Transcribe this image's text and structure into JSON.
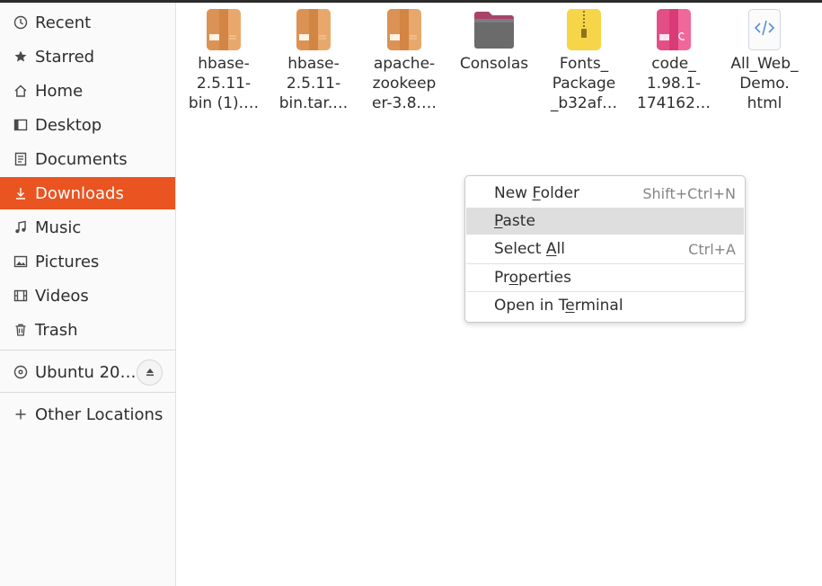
{
  "sidebar": {
    "items": [
      {
        "label": "Recent",
        "icon": "clock-icon"
      },
      {
        "label": "Starred",
        "icon": "star-icon"
      },
      {
        "label": "Home",
        "icon": "home-icon"
      },
      {
        "label": "Desktop",
        "icon": "desktop-icon"
      },
      {
        "label": "Documents",
        "icon": "document-icon"
      },
      {
        "label": "Downloads",
        "icon": "download-icon",
        "active": true
      },
      {
        "label": "Music",
        "icon": "music-icon"
      },
      {
        "label": "Pictures",
        "icon": "pictures-icon"
      },
      {
        "label": "Videos",
        "icon": "video-icon"
      },
      {
        "label": "Trash",
        "icon": "trash-icon"
      }
    ],
    "drive": {
      "label": "Ubuntu 20…",
      "icon": "disc-icon",
      "eject_icon": "eject-icon"
    },
    "other_locations": {
      "label": "Other Locations",
      "icon": "plus-icon"
    },
    "accent": "#e95420"
  },
  "files": [
    {
      "name": "hbase-\n2.5.11-\nbin (1).…",
      "icon": "archive-icon"
    },
    {
      "name": "hbase-\n2.5.11-\nbin.tar.…",
      "icon": "archive-icon"
    },
    {
      "name": "apache-\nzookeep\ner-3.8.…",
      "icon": "archive-icon"
    },
    {
      "name": "Consolas",
      "icon": "folder-icon"
    },
    {
      "name": "Fonts_\nPackage\n_b32af…",
      "icon": "zip-icon"
    },
    {
      "name": "code_\n1.98.1-\n174162…",
      "icon": "deb-package-icon"
    },
    {
      "name": "All_Web_\nDemo.\nhtml",
      "icon": "html-file-icon"
    }
  ],
  "context_menu": {
    "items": [
      {
        "pre": "New ",
        "mnemonic": "F",
        "post": "older",
        "shortcut": "Shift+Ctrl+N"
      },
      {
        "pre": "",
        "mnemonic": "P",
        "post": "aste",
        "shortcut": "",
        "hover": true
      },
      {
        "pre": "Select ",
        "mnemonic": "A",
        "post": "ll",
        "shortcut": "Ctrl+A"
      },
      {
        "pre": "Pr",
        "mnemonic": "o",
        "post": "perties",
        "shortcut": ""
      },
      {
        "pre": "Open in T",
        "mnemonic": "e",
        "post": "rminal",
        "shortcut": ""
      }
    ]
  }
}
